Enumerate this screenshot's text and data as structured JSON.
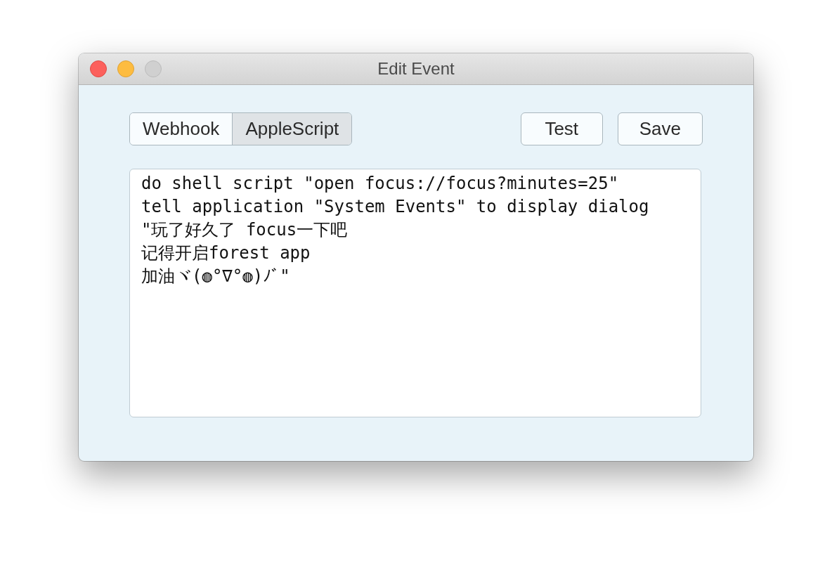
{
  "window": {
    "title": "Edit Event",
    "controls": [
      {
        "kind": "close"
      },
      {
        "kind": "minimize"
      },
      {
        "kind": "zoom",
        "disabled": true
      }
    ]
  },
  "tabs": [
    {
      "label": "Webhook",
      "selected": false
    },
    {
      "label": "AppleScript",
      "selected": true
    }
  ],
  "buttons": [
    "Test",
    "Save"
  ],
  "script_editor": {
    "lines": [
      "do shell script \"open focus://focus?minutes=25\"",
      "tell application \"System Events\" to display dialog \"玩了好久了 focus一下吧",
      "记得开启forest app",
      "加油ヾ(◍°∇°◍)ﾉﾞ\""
    ]
  }
}
